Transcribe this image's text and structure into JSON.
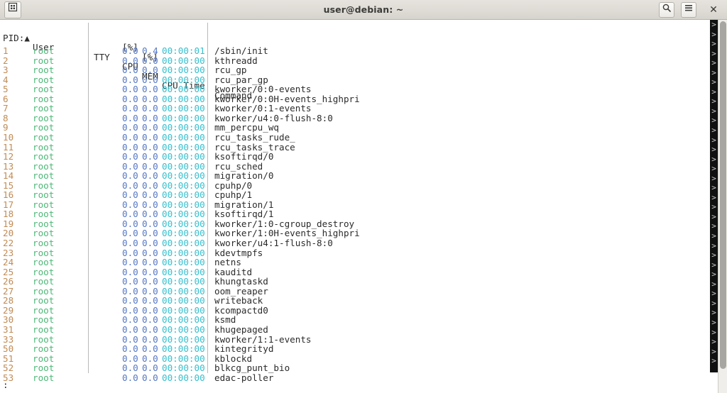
{
  "window": {
    "title": "user@debian: ~",
    "new_tab_icon": "new-terminal-icon",
    "search_icon": "search-icon",
    "menu_icon": "hamburger-menu-icon",
    "close_label": "✕"
  },
  "colors": {
    "titlebar_bg": "#dedbd5",
    "screen_bg": "#ffffff",
    "pid": "#c18b55",
    "user": "#4cb877",
    "cpu": "#5577c4",
    "mem": "#5577c4",
    "cpu_time": "#34bfce",
    "command": "#2b2b2b",
    "wrap_gutter_bg": "#111111",
    "scrollbar_thumb": "#a8a6a1"
  },
  "table": {
    "headers": {
      "pid": "PID:▲",
      "user": "User",
      "tty": "TTY",
      "cpu": "CPU",
      "mem": "MEM",
      "cpu_time": "CPU Time",
      "command": "Command",
      "cpu_unit": "[%]",
      "mem_unit": "[%]"
    },
    "sort_column": "PID",
    "sort_direction": "ascending",
    "rows": [
      {
        "pid": "1",
        "user": "root",
        "tty": "",
        "cpu": "0.0",
        "mem": "0.4",
        "cpu_time": "00:00:01",
        "command": "/sbin/init"
      },
      {
        "pid": "2",
        "user": "root",
        "tty": "",
        "cpu": "0.0",
        "mem": "0.0",
        "cpu_time": "00:00:00",
        "command": "kthreadd"
      },
      {
        "pid": "3",
        "user": "root",
        "tty": "",
        "cpu": "0.0",
        "mem": "0.0",
        "cpu_time": "00:00:00",
        "command": "rcu_gp"
      },
      {
        "pid": "4",
        "user": "root",
        "tty": "",
        "cpu": "0.0",
        "mem": "0.0",
        "cpu_time": "00:00:00",
        "command": "rcu_par_gp"
      },
      {
        "pid": "5",
        "user": "root",
        "tty": "",
        "cpu": "0.0",
        "mem": "0.0",
        "cpu_time": "00:00:00",
        "command": "kworker/0:0-events"
      },
      {
        "pid": "6",
        "user": "root",
        "tty": "",
        "cpu": "0.0",
        "mem": "0.0",
        "cpu_time": "00:00:00",
        "command": "kworker/0:0H-events_highpri"
      },
      {
        "pid": "7",
        "user": "root",
        "tty": "",
        "cpu": "0.0",
        "mem": "0.0",
        "cpu_time": "00:00:00",
        "command": "kworker/0:1-events"
      },
      {
        "pid": "8",
        "user": "root",
        "tty": "",
        "cpu": "0.0",
        "mem": "0.0",
        "cpu_time": "00:00:00",
        "command": "kworker/u4:0-flush-8:0"
      },
      {
        "pid": "9",
        "user": "root",
        "tty": "",
        "cpu": "0.0",
        "mem": "0.0",
        "cpu_time": "00:00:00",
        "command": "mm_percpu_wq"
      },
      {
        "pid": "10",
        "user": "root",
        "tty": "",
        "cpu": "0.0",
        "mem": "0.0",
        "cpu_time": "00:00:00",
        "command": "rcu_tasks_rude_"
      },
      {
        "pid": "11",
        "user": "root",
        "tty": "",
        "cpu": "0.0",
        "mem": "0.0",
        "cpu_time": "00:00:00",
        "command": "rcu_tasks_trace"
      },
      {
        "pid": "12",
        "user": "root",
        "tty": "",
        "cpu": "0.0",
        "mem": "0.0",
        "cpu_time": "00:00:00",
        "command": "ksoftirqd/0"
      },
      {
        "pid": "13",
        "user": "root",
        "tty": "",
        "cpu": "0.0",
        "mem": "0.0",
        "cpu_time": "00:00:00",
        "command": "rcu_sched"
      },
      {
        "pid": "14",
        "user": "root",
        "tty": "",
        "cpu": "0.0",
        "mem": "0.0",
        "cpu_time": "00:00:00",
        "command": "migration/0"
      },
      {
        "pid": "15",
        "user": "root",
        "tty": "",
        "cpu": "0.0",
        "mem": "0.0",
        "cpu_time": "00:00:00",
        "command": "cpuhp/0"
      },
      {
        "pid": "16",
        "user": "root",
        "tty": "",
        "cpu": "0.0",
        "mem": "0.0",
        "cpu_time": "00:00:00",
        "command": "cpuhp/1"
      },
      {
        "pid": "17",
        "user": "root",
        "tty": "",
        "cpu": "0.0",
        "mem": "0.0",
        "cpu_time": "00:00:00",
        "command": "migration/1"
      },
      {
        "pid": "18",
        "user": "root",
        "tty": "",
        "cpu": "0.0",
        "mem": "0.0",
        "cpu_time": "00:00:00",
        "command": "ksoftirqd/1"
      },
      {
        "pid": "19",
        "user": "root",
        "tty": "",
        "cpu": "0.0",
        "mem": "0.0",
        "cpu_time": "00:00:00",
        "command": "kworker/1:0-cgroup_destroy"
      },
      {
        "pid": "20",
        "user": "root",
        "tty": "",
        "cpu": "0.0",
        "mem": "0.0",
        "cpu_time": "00:00:00",
        "command": "kworker/1:0H-events_highpri"
      },
      {
        "pid": "22",
        "user": "root",
        "tty": "",
        "cpu": "0.0",
        "mem": "0.0",
        "cpu_time": "00:00:00",
        "command": "kworker/u4:1-flush-8:0"
      },
      {
        "pid": "23",
        "user": "root",
        "tty": "",
        "cpu": "0.0",
        "mem": "0.0",
        "cpu_time": "00:00:00",
        "command": "kdevtmpfs"
      },
      {
        "pid": "24",
        "user": "root",
        "tty": "",
        "cpu": "0.0",
        "mem": "0.0",
        "cpu_time": "00:00:00",
        "command": "netns"
      },
      {
        "pid": "25",
        "user": "root",
        "tty": "",
        "cpu": "0.0",
        "mem": "0.0",
        "cpu_time": "00:00:00",
        "command": "kauditd"
      },
      {
        "pid": "26",
        "user": "root",
        "tty": "",
        "cpu": "0.0",
        "mem": "0.0",
        "cpu_time": "00:00:00",
        "command": "khungtaskd"
      },
      {
        "pid": "27",
        "user": "root",
        "tty": "",
        "cpu": "0.0",
        "mem": "0.0",
        "cpu_time": "00:00:00",
        "command": "oom_reaper"
      },
      {
        "pid": "28",
        "user": "root",
        "tty": "",
        "cpu": "0.0",
        "mem": "0.0",
        "cpu_time": "00:00:00",
        "command": "writeback"
      },
      {
        "pid": "29",
        "user": "root",
        "tty": "",
        "cpu": "0.0",
        "mem": "0.0",
        "cpu_time": "00:00:00",
        "command": "kcompactd0"
      },
      {
        "pid": "30",
        "user": "root",
        "tty": "",
        "cpu": "0.0",
        "mem": "0.0",
        "cpu_time": "00:00:00",
        "command": "ksmd"
      },
      {
        "pid": "31",
        "user": "root",
        "tty": "",
        "cpu": "0.0",
        "mem": "0.0",
        "cpu_time": "00:00:00",
        "command": "khugepaged"
      },
      {
        "pid": "33",
        "user": "root",
        "tty": "",
        "cpu": "0.0",
        "mem": "0.0",
        "cpu_time": "00:00:00",
        "command": "kworker/1:1-events"
      },
      {
        "pid": "50",
        "user": "root",
        "tty": "",
        "cpu": "0.0",
        "mem": "0.0",
        "cpu_time": "00:00:00",
        "command": "kintegrityd"
      },
      {
        "pid": "51",
        "user": "root",
        "tty": "",
        "cpu": "0.0",
        "mem": "0.0",
        "cpu_time": "00:00:00",
        "command": "kblockd"
      },
      {
        "pid": "52",
        "user": "root",
        "tty": "",
        "cpu": "0.0",
        "mem": "0.0",
        "cpu_time": "00:00:00",
        "command": "blkcg_punt_bio"
      },
      {
        "pid": "53",
        "user": "root",
        "tty": "",
        "cpu": "0.0",
        "mem": "0.0",
        "cpu_time": "00:00:00",
        "command": "edac-poller"
      }
    ]
  },
  "prompt": {
    "text": ":"
  },
  "wrap_gutter": {
    "marker": ">",
    "count": 36
  }
}
